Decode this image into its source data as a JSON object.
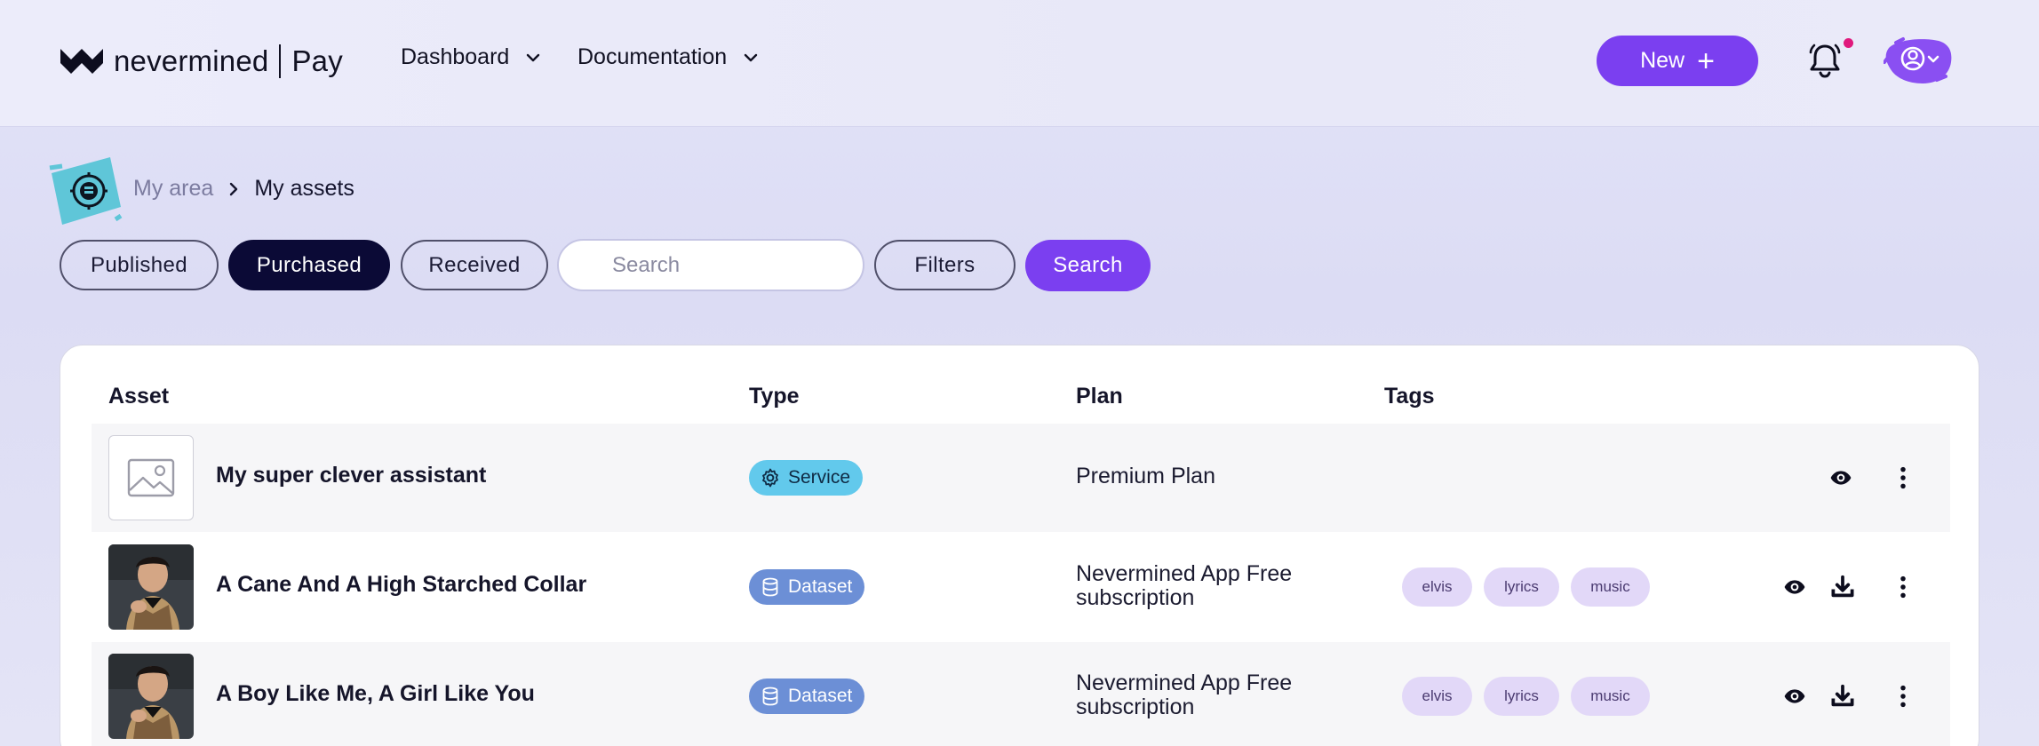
{
  "header": {
    "brand": "nevermined",
    "product": "Pay",
    "nav": [
      {
        "label": "Dashboard"
      },
      {
        "label": "Documentation"
      }
    ],
    "new_button": "New"
  },
  "breadcrumb": {
    "parent": "My area",
    "current": "My assets"
  },
  "filters": {
    "tabs": [
      {
        "label": "Published",
        "active": false
      },
      {
        "label": "Purchased",
        "active": true
      },
      {
        "label": "Received",
        "active": false
      }
    ],
    "search_placeholder": "Search",
    "filters_label": "Filters",
    "search_button": "Search"
  },
  "table": {
    "columns": [
      "Asset",
      "Type",
      "Plan",
      "Tags"
    ],
    "rows": [
      {
        "name": "My super clever assistant",
        "type": "Service",
        "type_icon": "gear-icon",
        "plan_line1": "Premium Plan",
        "plan_line2": "",
        "tags": [],
        "thumbnail": "image-placeholder-icon",
        "actions": [
          "eye-icon",
          "more-vertical-icon"
        ]
      },
      {
        "name": "A Cane And A High Starched Collar",
        "type": "Dataset",
        "type_icon": "database-icon",
        "plan_line1": "Nevermined App Free",
        "plan_line2": "subscription",
        "tags": [
          "elvis",
          "lyrics",
          "music"
        ],
        "thumbnail": "artist-photo",
        "actions": [
          "eye-icon",
          "download-icon",
          "more-vertical-icon"
        ]
      },
      {
        "name": "A Boy Like Me, A Girl Like You",
        "type": "Dataset",
        "type_icon": "database-icon",
        "plan_line1": "Nevermined App Free",
        "plan_line2": "subscription",
        "tags": [
          "elvis",
          "lyrics",
          "music"
        ],
        "thumbnail": "artist-photo",
        "actions": [
          "eye-icon",
          "download-icon",
          "more-vertical-icon"
        ]
      }
    ]
  },
  "colors": {
    "accent": "#7b3ff0",
    "active_tab": "#0b0a36",
    "service_badge": "#62c9ec",
    "dataset_badge": "#6c8fd6",
    "tag_bg": "#e2d8f8",
    "notification_dot": "#e0197d"
  }
}
